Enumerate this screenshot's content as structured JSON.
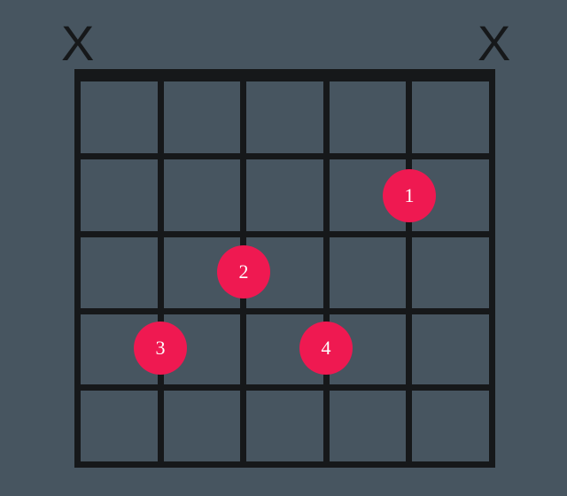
{
  "chart_data": {
    "type": "guitar-chord-diagram",
    "strings": 6,
    "frets": 5,
    "string_markers": [
      "X",
      "",
      "",
      "",
      "",
      "X"
    ],
    "fingers": [
      {
        "string": 5,
        "fret": 2,
        "label": "1"
      },
      {
        "string": 3,
        "fret": 3,
        "label": "2"
      },
      {
        "string": 2,
        "fret": 4,
        "label": "3"
      },
      {
        "string": 4,
        "fret": 4,
        "label": "4"
      }
    ],
    "mute_symbol": "X",
    "colors": {
      "dot": "#ef1951",
      "grid": "#16181a",
      "bg": "#475560"
    }
  },
  "mute_label_1": "X",
  "mute_label_2": "X",
  "finger_1": "1",
  "finger_2": "2",
  "finger_3": "3",
  "finger_4": "4"
}
